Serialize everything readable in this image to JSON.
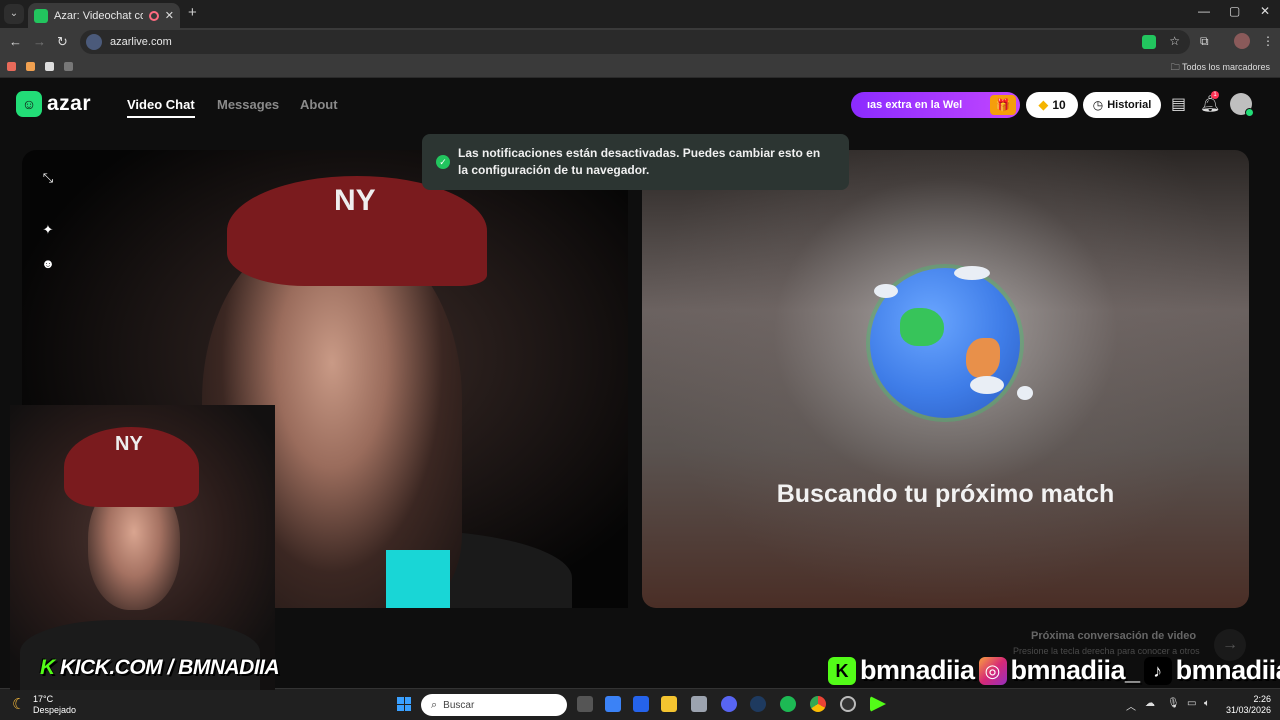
{
  "browser": {
    "tab_title": "Azar: Videochat con gente",
    "close_tab": "✕",
    "new_tab": "+",
    "url": "azarlive.com",
    "bookmarks_all": "Todos los marcadores",
    "window_controls": {
      "minimize": "—",
      "maximize": "▢",
      "close": "✕"
    }
  },
  "header": {
    "logo_text": "azar",
    "nav": {
      "video_chat": "Video Chat",
      "messages": "Messages",
      "about": "About"
    },
    "promo_text": "ıas extra en la Wel",
    "gems_count": "10",
    "history_label": "Historial",
    "notification_count": "1"
  },
  "toast": {
    "message": "Las notificaciones están desactivadas. Puedes cambiar esto en la configuración de tu navegador."
  },
  "match": {
    "searching_text": "Buscando tu próximo match",
    "next_title": "Próxima conversación de video",
    "next_hint": "Presione la tecla derecha para conocer a otros",
    "next_arrow": "→"
  },
  "left_video": {
    "cap_logo": "NY"
  },
  "overlays": {
    "kick_k": "K",
    "kick_text": "KICK.COM / BMNADIIA",
    "social_handles": [
      "bmnadiia",
      "bmnadiia_",
      "bmnadiia"
    ]
  },
  "taskbar": {
    "weather_temp": "17°C",
    "weather_desc": "Despejado",
    "search_placeholder": "Buscar",
    "time": "2:26",
    "date": "31/03/2026"
  },
  "colors": {
    "brand_green": "#22dd77",
    "promo_purple": "#a33bff",
    "kick_green": "#53fc18"
  }
}
